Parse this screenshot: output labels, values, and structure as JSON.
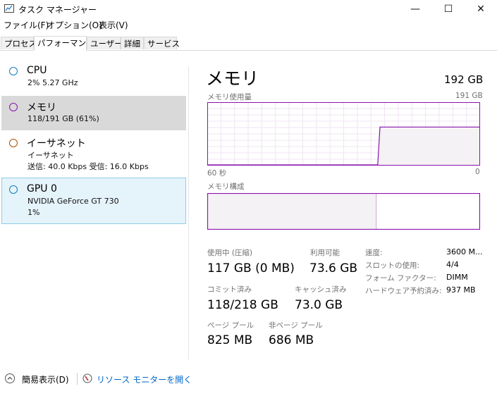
{
  "window": {
    "title": "タスク マネージャー",
    "minimize_glyph": "—",
    "maximize_glyph": "☐",
    "close_glyph": "✕"
  },
  "menu": [
    "ファイル(F)",
    "オプション(O)",
    "表示(V)"
  ],
  "tabs": [
    "プロセス",
    "パフォーマンス",
    "ユーザー",
    "詳細",
    "サービス"
  ],
  "active_tab": "パフォーマンス",
  "sidebar": {
    "items": [
      {
        "title": "CPU",
        "line1": "2%  5.27 GHz",
        "line2": "",
        "line3": "",
        "color": "#117dbb"
      },
      {
        "title": "メモリ",
        "line1": "118/191 GB (61%)",
        "line2": "",
        "line3": "",
        "color": "#8b12ae"
      },
      {
        "title": "イーサネット",
        "line1": "イーサネット",
        "line2": "送信: 40.0 Kbps 受信: 16.0 Kbps",
        "line3": "",
        "color": "#a74f01"
      },
      {
        "title": "GPU 0",
        "line1": "NVIDIA GeForce GT 730",
        "line2": "1%",
        "line3": "",
        "color": "#117dbb"
      }
    ]
  },
  "main": {
    "heading": "メモリ",
    "total": "192 GB",
    "usage_graph": {
      "label": "メモリ使用量",
      "max_label": "191 GB",
      "time_left": "60 秒",
      "time_right": "0",
      "accent": "#8b12ae",
      "fill": "#f4f2f4",
      "values_pct": [
        0,
        0,
        0,
        0,
        0,
        0,
        0,
        0,
        0,
        0,
        0,
        0,
        0,
        0,
        0,
        0,
        0,
        0,
        0,
        0,
        0,
        0,
        0,
        0,
        0,
        0,
        0,
        0,
        0,
        0,
        0,
        0,
        0,
        0,
        0,
        0,
        0,
        0,
        0,
        0,
        0,
        0,
        0,
        0,
        0,
        0,
        0,
        0,
        0,
        0,
        0,
        0,
        0,
        0,
        0,
        0,
        0,
        0,
        0,
        0,
        0,
        0,
        0,
        0,
        0,
        0,
        0,
        0,
        0,
        0,
        0,
        0,
        0,
        0,
        0,
        0,
        61,
        61,
        61,
        61,
        61,
        61,
        61,
        61,
        61,
        61,
        61,
        61,
        61,
        61,
        61,
        61,
        61,
        61,
        61,
        61,
        61,
        61,
        61,
        61,
        61,
        61,
        61,
        61,
        61,
        61,
        61,
        61,
        61,
        61,
        61,
        61,
        61,
        61,
        61,
        61,
        61,
        61,
        61,
        61,
        61
      ]
    },
    "composition": {
      "label": "メモリ構成",
      "in_use_fraction": 0.62
    },
    "stats": {
      "in_use_label": "使用中 (圧縮)",
      "in_use_value": "117 GB (0 MB)",
      "available_label": "利用可能",
      "available_value": "73.6 GB",
      "committed_label": "コミット済み",
      "committed_value": "118/218 GB",
      "cached_label": "キャッシュ済み",
      "cached_value": "73.0 GB",
      "paged_label": "ページ プール",
      "paged_value": "825 MB",
      "nonpaged_label": "非ページ プール",
      "nonpaged_value": "686 MB"
    },
    "details": [
      {
        "label": "速度:",
        "value": "3600 M..."
      },
      {
        "label": "スロットの使用:",
        "value": "4/4"
      },
      {
        "label": "フォーム ファクター:",
        "value": "DIMM"
      },
      {
        "label": "ハードウェア予約済み:",
        "value": "937 MB"
      }
    ]
  },
  "footer": {
    "fewer_details": "簡易表示(D)",
    "resource_monitor": "リソース モニターを開く",
    "link_color": "#0066cc"
  }
}
